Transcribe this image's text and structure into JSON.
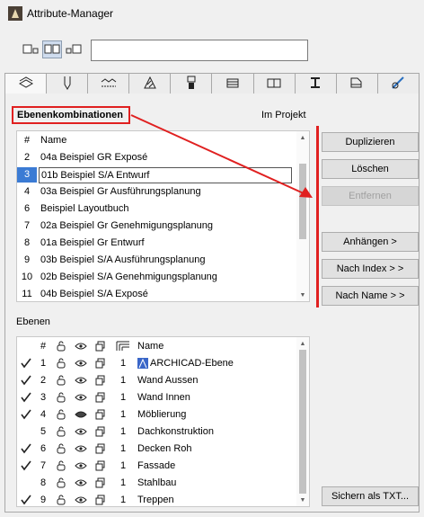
{
  "window": {
    "title": "Attribute-Manager"
  },
  "search": {
    "value": "",
    "placeholder": ""
  },
  "tabs": [
    {
      "icon": "layers-icon",
      "active": true
    },
    {
      "icon": "pen-icon",
      "active": false
    },
    {
      "icon": "line-type-icon",
      "active": false
    },
    {
      "icon": "fill-icon",
      "active": false
    },
    {
      "icon": "paint-brush-icon",
      "active": false
    },
    {
      "icon": "composite-icon",
      "active": false
    },
    {
      "icon": "building-material-icon",
      "active": false
    },
    {
      "icon": "profile-icon",
      "active": false
    },
    {
      "icon": "zone-icon",
      "active": false
    },
    {
      "icon": "surface-icon",
      "active": false
    }
  ],
  "combinations": {
    "heading": "Ebenenkombinationen",
    "scope_label": "Im Projekt",
    "col_num": "#",
    "col_name": "Name",
    "rows": [
      {
        "num": "2",
        "name": "04a Beispiel GR Exposé"
      },
      {
        "num": "3",
        "name": "01b Beispiel S/A Entwurf",
        "selected": true
      },
      {
        "num": "4",
        "name": "03a Beispiel Gr Ausführungsplanung"
      },
      {
        "num": "6",
        "name": "Beispiel Layoutbuch"
      },
      {
        "num": "7",
        "name": "02a Beispiel Gr Genehmigungsplanung"
      },
      {
        "num": "8",
        "name": "01a Beispiel Gr Entwurf"
      },
      {
        "num": "9",
        "name": "03b Beispiel S/A Ausführungsplanung"
      },
      {
        "num": "10",
        "name": "02b Beispiel S/A Genehmigungsplanung"
      },
      {
        "num": "11",
        "name": "04b Beispiel S/A Exposé"
      }
    ]
  },
  "buttons": {
    "duplicate": "Duplizieren",
    "delete": "Löschen",
    "remove": "Entfernen",
    "append": "Anhängen >",
    "by_index": "Nach Index > >",
    "by_name": "Nach Name > >",
    "save_txt": "Sichern als TXT..."
  },
  "layers": {
    "heading": "Ebenen",
    "col_num": "#",
    "col_name": "Name",
    "rows": [
      {
        "checked": true,
        "num": "1",
        "visible": true,
        "pen": "1",
        "name": "ARCHICAD-Ebene",
        "special": true
      },
      {
        "checked": true,
        "num": "2",
        "visible": true,
        "pen": "1",
        "name": "Wand Aussen"
      },
      {
        "checked": true,
        "num": "3",
        "visible": true,
        "pen": "1",
        "name": "Wand Innen"
      },
      {
        "checked": true,
        "num": "4",
        "visible": false,
        "pen": "1",
        "name": "Möblierung"
      },
      {
        "checked": false,
        "num": "5",
        "visible": true,
        "pen": "1",
        "name": "Dachkonstruktion"
      },
      {
        "checked": true,
        "num": "6",
        "visible": true,
        "pen": "1",
        "name": "Decken Roh"
      },
      {
        "checked": true,
        "num": "7",
        "visible": true,
        "pen": "1",
        "name": "Fassade"
      },
      {
        "checked": false,
        "num": "8",
        "visible": true,
        "pen": "1",
        "name": "Stahlbau"
      },
      {
        "checked": true,
        "num": "9",
        "visible": true,
        "pen": "1",
        "name": "Treppen"
      }
    ]
  },
  "colors": {
    "annotation_red": "#e02020",
    "selection_blue": "#3b7bd4"
  }
}
